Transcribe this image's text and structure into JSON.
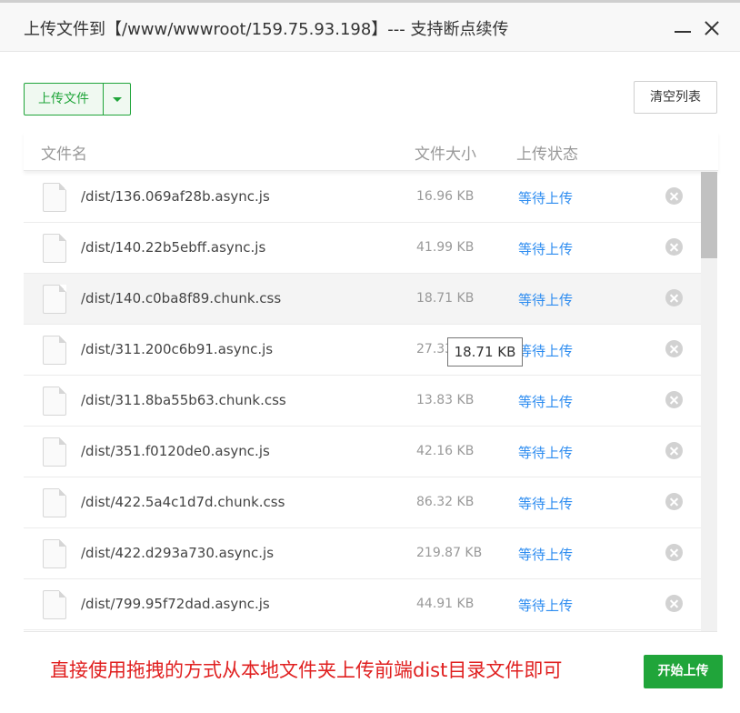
{
  "dialog": {
    "title": "上传文件到【/www/wwwroot/159.75.93.198】--- 支持断点续传"
  },
  "toolbar": {
    "upload_label": "上传文件",
    "clear_label": "清空列表"
  },
  "table": {
    "columns": [
      "文件名",
      "文件大小",
      "上传状态"
    ],
    "rows": [
      {
        "name": "/dist/136.069af28b.async.js",
        "size": "16.96 KB",
        "status": "等待上传"
      },
      {
        "name": "/dist/140.22b5ebff.async.js",
        "size": "41.99 KB",
        "status": "等待上传"
      },
      {
        "name": "/dist/140.c0ba8f89.chunk.css",
        "size": "18.71 KB",
        "status": "等待上传"
      },
      {
        "name": "/dist/311.200c6b91.async.js",
        "size": "27.33",
        "status": "等待上传"
      },
      {
        "name": "/dist/311.8ba55b63.chunk.css",
        "size": "13.83 KB",
        "status": "等待上传"
      },
      {
        "name": "/dist/351.f0120de0.async.js",
        "size": "42.16 KB",
        "status": "等待上传"
      },
      {
        "name": "/dist/422.5a4c1d7d.chunk.css",
        "size": "86.32 KB",
        "status": "等待上传"
      },
      {
        "name": "/dist/422.d293a730.async.js",
        "size": "219.87 KB",
        "status": "等待上传"
      },
      {
        "name": "/dist/799.95f72dad.async.js",
        "size": "44.91 KB",
        "status": "等待上传"
      }
    ]
  },
  "tooltip": {
    "text": "18.71 KB"
  },
  "footer": {
    "hint": "直接使用拖拽的方式从本地文件夹上传前端dist目录文件即可",
    "start_label": "开始上传"
  },
  "colors": {
    "accent": "#20a53a",
    "status": "#2d8cf0",
    "hint": "#e02020"
  }
}
